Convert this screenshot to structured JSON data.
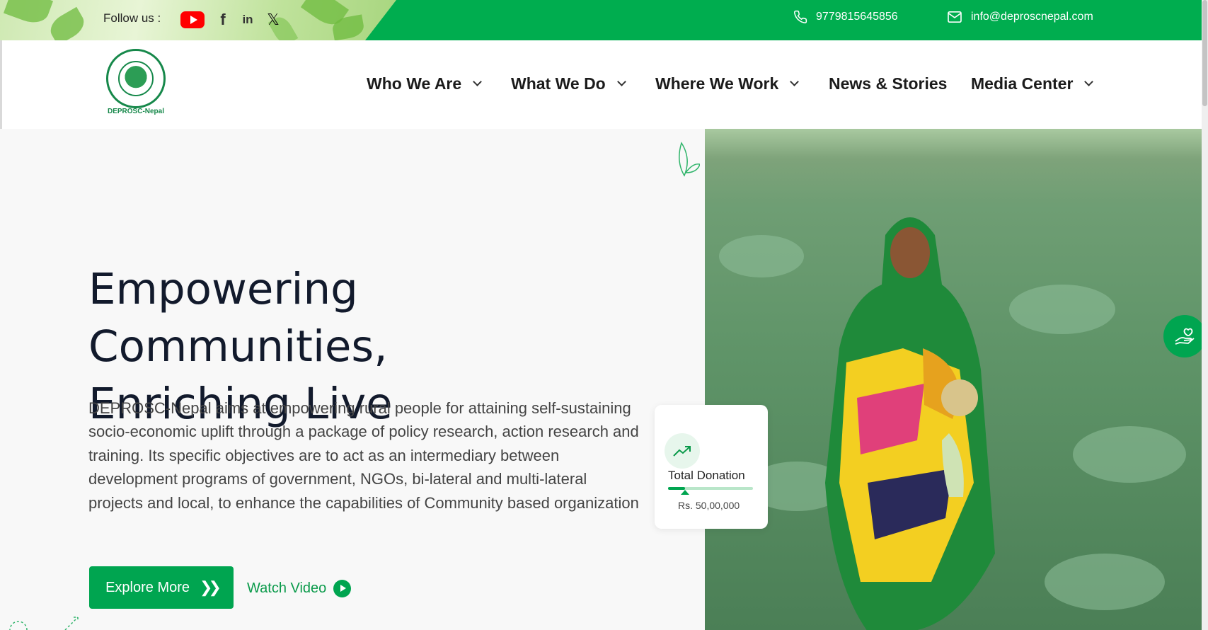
{
  "topbar": {
    "follow_label": "Follow us :",
    "social": [
      "youtube-icon",
      "facebook-icon",
      "linkedin-icon",
      "x-icon"
    ],
    "phone": "9779815645856",
    "email": "info@deproscnepal.com"
  },
  "logo": {
    "caption": "DEPROSC-Nepal"
  },
  "nav": {
    "items": [
      {
        "label": "Who We Are",
        "dropdown": true
      },
      {
        "label": "What We Do",
        "dropdown": true
      },
      {
        "label": "Where We Work",
        "dropdown": true
      },
      {
        "label": "News & Stories",
        "dropdown": false
      },
      {
        "label": "Media Center",
        "dropdown": true
      }
    ]
  },
  "hero": {
    "heading_line1": "Empowering Communities,",
    "heading_line2": "Enriching Live",
    "description": "DEPROSC-Nepal aims at empowering rural people for attaining self-sustaining socio-economic uplift through a package of policy research, action research and training. Its specific objectives are to act as an intermediary between development programs of government, NGOs, bi-lateral and multi-lateral projects and local, to enhance the capabilities of Community based organization",
    "explore_label": "Explore More",
    "watch_label": "Watch Video"
  },
  "donation": {
    "label": "Total Donation",
    "amount": "Rs. 50,00,000",
    "progress": 0.2
  },
  "colors": {
    "brand_green": "#00ad4f",
    "button_green": "#00a550",
    "heading": "#121a2c"
  }
}
